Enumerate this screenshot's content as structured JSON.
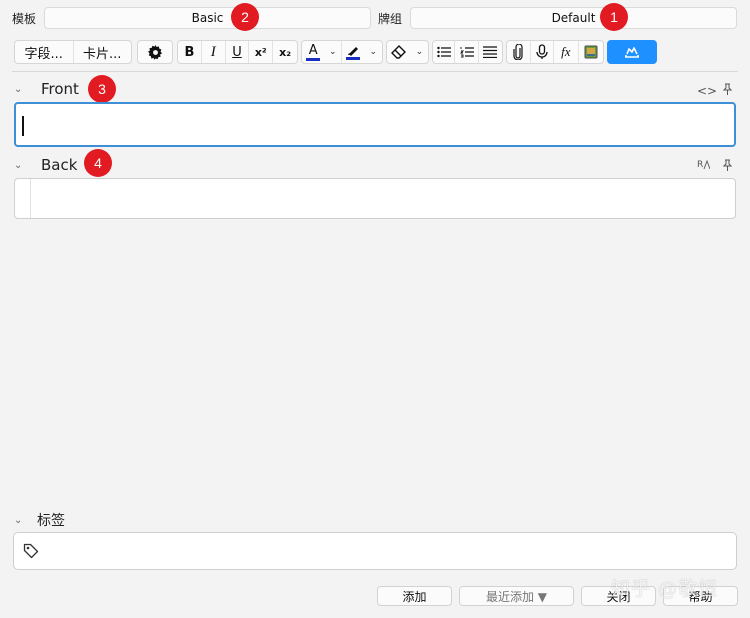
{
  "header": {
    "notetype_label": "模板",
    "notetype_value": "Basic",
    "deck_label": "牌组",
    "deck_value": "Default"
  },
  "badges": [
    "1",
    "2",
    "3",
    "4"
  ],
  "toolbar": {
    "fields_label": "字段...",
    "cards_label": "卡片...",
    "icons": [
      "gear-icon",
      "bold-icon",
      "italic-icon",
      "underline-icon",
      "superscript-icon",
      "subscript-icon",
      "text-color-icon",
      "highlight-icon",
      "eraser-icon",
      "bullet-list-icon",
      "numbered-list-icon",
      "align-icon",
      "paperclip-icon",
      "microphone-icon",
      "math-icon",
      "image-occlusion-icon",
      "cloud-icon"
    ],
    "bold": "B",
    "italic": "I",
    "underline": "U",
    "superscript": "x²",
    "subscript": "x₂",
    "text_color_glyph": "A",
    "math_glyph": "fx",
    "accent_color": "#1e90ff",
    "text_color": "#1a2fbf"
  },
  "fields": [
    {
      "name": "Front",
      "value": ""
    },
    {
      "name": "Back",
      "value": ""
    }
  ],
  "tags": {
    "label": "标签",
    "value": ""
  },
  "buttons": {
    "add": "添加",
    "history": "最近添加 ▼",
    "close": "关闭",
    "help": "帮助"
  },
  "watermark": "知乎 @敬恒"
}
